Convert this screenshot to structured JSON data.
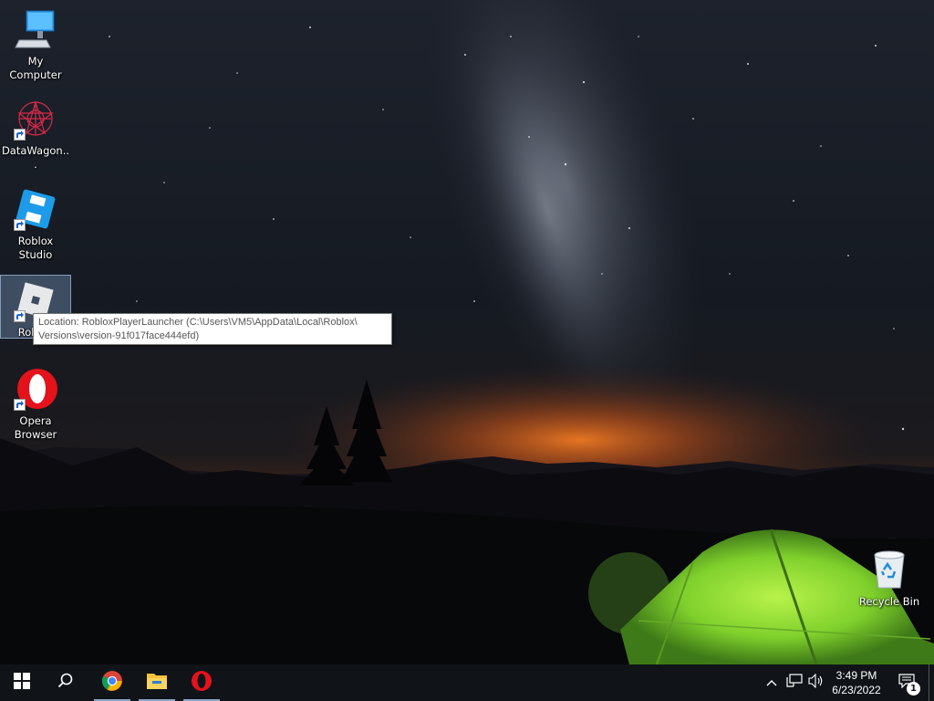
{
  "desktop": {
    "icons": [
      {
        "label": "My Computer"
      },
      {
        "label": "DataWagon..."
      },
      {
        "label": "Roblox Studio"
      },
      {
        "label": "Roblox"
      },
      {
        "label": "Opera Browser"
      }
    ],
    "recycle_bin": {
      "label": "Recycle Bin"
    }
  },
  "tooltip": {
    "line1": "Location: RobloxPlayerLauncher (C:\\Users\\VM5\\AppData\\Local\\Roblox\\",
    "line2": "Versions\\version-91f017face444efd)"
  },
  "taskbar": {
    "start_icon": "windows-logo-icon",
    "search_icon": "search-icon",
    "pinned": [
      "chrome-icon",
      "file-explorer-icon",
      "opera-icon"
    ],
    "tray": {
      "chevron_icon": "chevron-up-icon",
      "network_icon": "network-icon",
      "volume_icon": "volume-icon",
      "time": "3:49 PM",
      "date": "6/23/2022",
      "notification_count": "1"
    }
  },
  "colors": {
    "taskbar_bg": "#101418",
    "tent_green": "#7fd02c",
    "horizon_glow": "#e0621a",
    "roblox_studio_blue": "#1e9be8",
    "opera_red": "#e4121b"
  }
}
